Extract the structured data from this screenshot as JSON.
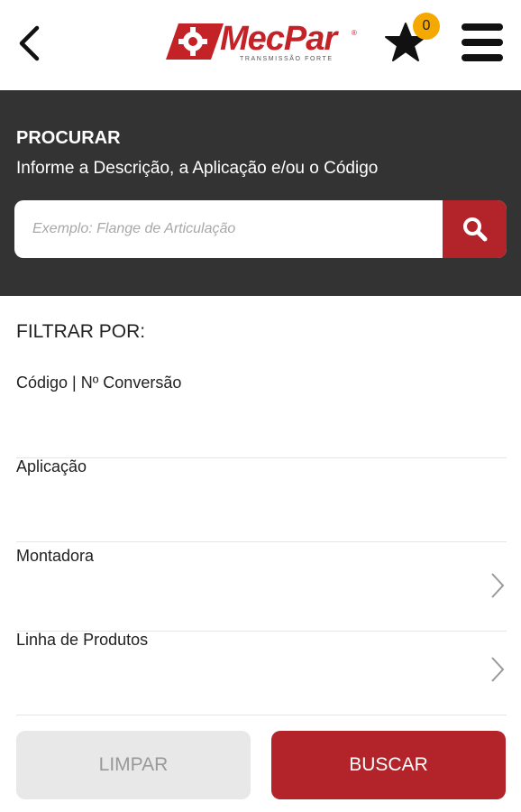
{
  "header": {
    "logo": {
      "name": "MecPar",
      "tagline": "TRANSMISSÃO FORTE",
      "registered": "®"
    },
    "favorites_count": "0",
    "icons": {
      "back": "chevron-left-icon",
      "favorites": "star-icon",
      "menu": "hamburger-menu-icon"
    }
  },
  "search": {
    "title": "PROCURAR",
    "subtitle": "Informe a Descrição, a Aplicação e/ou o Código",
    "placeholder": "Exemplo: Flange de Articulação",
    "value": "",
    "button_icon": "search-icon"
  },
  "filters": {
    "title": "FILTRAR POR:",
    "items": [
      {
        "label": "Código | Nº Conversão",
        "has_chevron": false
      },
      {
        "label": "Aplicação",
        "has_chevron": false
      },
      {
        "label": "Montadora",
        "has_chevron": true
      },
      {
        "label": "Linha de Produtos",
        "has_chevron": true
      }
    ]
  },
  "actions": {
    "clear_label": "LIMPAR",
    "search_label": "BUSCAR"
  },
  "colors": {
    "brand_red": "#b3242a",
    "panel_dark": "#333333",
    "badge": "#f5a800"
  }
}
